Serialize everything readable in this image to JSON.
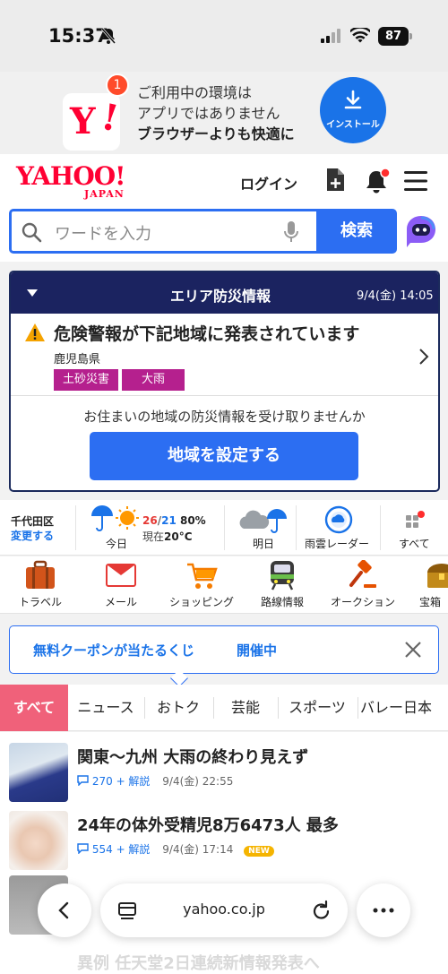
{
  "status_bar": {
    "time": "15:37",
    "battery": "87"
  },
  "app_banner": {
    "badge": "1",
    "line1": "ご利用中の環境は",
    "line2": "アプリではありません",
    "line3": "ブラウザーよりも快適に",
    "install_label": "インストール"
  },
  "header": {
    "logo_main": "YAHOO!",
    "logo_sub": "JAPAN",
    "login": "ログイン"
  },
  "search": {
    "placeholder": "ワードを入力",
    "button": "検索"
  },
  "disaster": {
    "title": "エリア防災情報",
    "datetime": "9/4(金) 14:05",
    "warning": "危険警報が下記地域に発表されています",
    "prefecture": "鹿児島県",
    "tags": [
      "土砂災害",
      "大雨"
    ],
    "prompt": "お住まいの地域の防災情報を受け取りませんか",
    "button": "地域を設定する"
  },
  "weather": {
    "area": "千代田区",
    "change": "変更する",
    "today_label": "今日",
    "today_high": "26",
    "today_low": "21",
    "today_precip": "80%",
    "current_label": "現在",
    "current_temp": "20°C",
    "tomorrow_label": "明日",
    "radar_label": "雨雲レーダー",
    "all_label": "すべて"
  },
  "services": [
    "トラベル",
    "メール",
    "ショッピング",
    "路線情報",
    "オークション",
    "宝箱"
  ],
  "coupon": {
    "text": "無料クーポンが当たるくじ",
    "status": "開催中"
  },
  "tabs": [
    "すべて",
    "ニュース",
    "おトク",
    "芸能",
    "スポーツ",
    "バレー日本"
  ],
  "news": [
    {
      "title": "関東〜九州 大雨の終わり見えず",
      "comments": "270",
      "extra": "+ 解説",
      "date": "9/4(金) 22:55",
      "is_new": false
    },
    {
      "title": "24年の体外受精児8万6473人 最多",
      "comments": "554",
      "extra": "+ 解説",
      "date": "9/4(金) 17:14",
      "is_new": true,
      "new_label": "NEW"
    }
  ],
  "news_faded": "異例 任天堂2日連続新情報発表へ",
  "browser": {
    "url": "yahoo.co.jp"
  },
  "colors": {
    "brand_red": "#ff0033",
    "accent_blue": "#2c6ef2",
    "tab_active": "#f0617a",
    "warning_tag": "#b5208e",
    "disaster_bar": "#1b2360"
  }
}
